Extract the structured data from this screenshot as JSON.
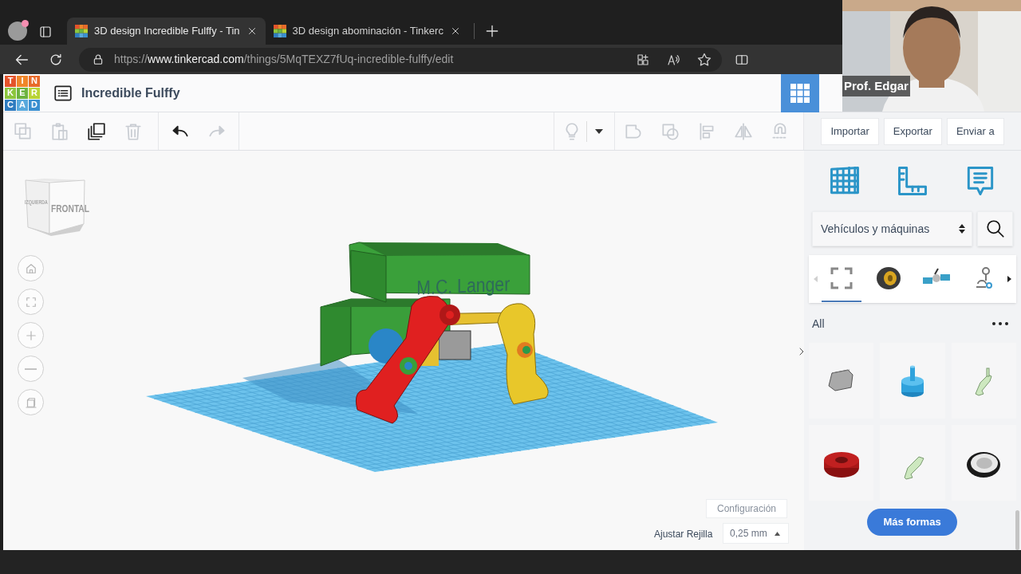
{
  "browser": {
    "tabs": [
      {
        "title": "3D design Incredible Fulffy - Tin",
        "selected": true
      },
      {
        "title": "3D design abominación - Tinkerc",
        "selected": false
      }
    ],
    "url": {
      "scheme": "https://",
      "host": "www.tinkercad.com",
      "path": "/things/5MqTEXZ7fUq-incredible-fulffy/edit"
    }
  },
  "app": {
    "logo": [
      {
        "letter": "T",
        "color": "#e4532b"
      },
      {
        "letter": "I",
        "color": "#f0862a"
      },
      {
        "letter": "N",
        "color": "#e86a2a"
      },
      {
        "letter": "K",
        "color": "#8cc63e"
      },
      {
        "letter": "E",
        "color": "#6db33f"
      },
      {
        "letter": "R",
        "color": "#b9d437"
      },
      {
        "letter": "C",
        "color": "#2f7cc0"
      },
      {
        "letter": "A",
        "color": "#58a9dd"
      },
      {
        "letter": "D",
        "color": "#3a8fd0"
      }
    ],
    "design_title": "Incredible Fulffy"
  },
  "toolbar": {
    "edit_tools": [
      {
        "kind": "copy",
        "disabled": true
      },
      {
        "kind": "paste",
        "disabled": true
      },
      {
        "kind": "duplicate",
        "disabled": false
      },
      {
        "kind": "delete",
        "disabled": true
      }
    ],
    "history_tools": [
      {
        "kind": "undo",
        "disabled": false
      },
      {
        "kind": "redo",
        "disabled": true
      }
    ],
    "shape_tools": [
      {
        "kind": "group",
        "disabled": true
      },
      {
        "kind": "ungroup",
        "disabled": true
      },
      {
        "kind": "align",
        "disabled": true
      },
      {
        "kind": "mirror",
        "disabled": true
      },
      {
        "kind": "magnet",
        "disabled": true
      }
    ],
    "actions": [
      "Importar",
      "Exportar",
      "Enviar a"
    ]
  },
  "viewport": {
    "view_cube": {
      "front": "FRONTAL",
      "left": "IZQUIERDA"
    },
    "model_text": "M.C. Langer",
    "view_controls": [
      {
        "kind": "home"
      },
      {
        "kind": "fit"
      },
      {
        "kind": "zoom_in"
      },
      {
        "kind": "zoom_out"
      },
      {
        "kind": "ortho"
      }
    ],
    "settings": "Configuración",
    "snap_label": "Ajustar Rejilla",
    "snap_value": "0,25 mm"
  },
  "panel": {
    "tools": [
      {
        "kind": "workplane"
      },
      {
        "kind": "ruler"
      },
      {
        "kind": "notes"
      }
    ],
    "category": "Vehículos y máquinas",
    "carousel": [
      {
        "kind": "fit",
        "selected": true
      },
      {
        "kind": "tire",
        "selected": false
      },
      {
        "kind": "satellite",
        "selected": false
      },
      {
        "kind": "robot",
        "selected": false
      }
    ],
    "section": "All",
    "shapes": [
      {
        "kind": "van"
      },
      {
        "kind": "peg"
      },
      {
        "kind": "bracket"
      },
      {
        "kind": "ring"
      },
      {
        "kind": "arm"
      },
      {
        "kind": "wheel"
      }
    ],
    "more_button": "Más formas"
  },
  "webcam": {
    "name": "Prof. Edgar"
  }
}
